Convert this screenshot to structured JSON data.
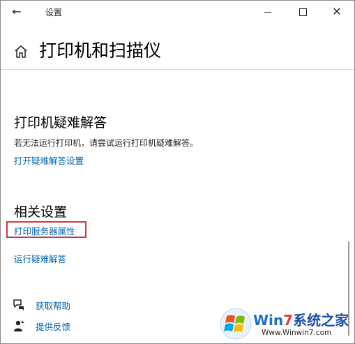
{
  "window": {
    "title": "设置",
    "back_glyph": "←",
    "close_glyph": "✕"
  },
  "header": {
    "title": "打印机和扫描仪"
  },
  "troubleshoot": {
    "heading": "打印机疑难解答",
    "description": "若无法运行打印机，请尝试运行打印机疑难解答。",
    "link": "打开疑难解答设置"
  },
  "related": {
    "heading": "相关设置",
    "links": [
      "打印服务器属性",
      "运行疑难解答"
    ]
  },
  "help": {
    "get_help": "获取帮助",
    "feedback": "提供反馈"
  },
  "watermark": {
    "brand_win": "Win",
    "brand_num": "7",
    "brand_rest": "系统之家",
    "url": "Www.Winwin7.com"
  },
  "colors": {
    "link": "#0063b1",
    "highlight": "#cf3b3b"
  }
}
